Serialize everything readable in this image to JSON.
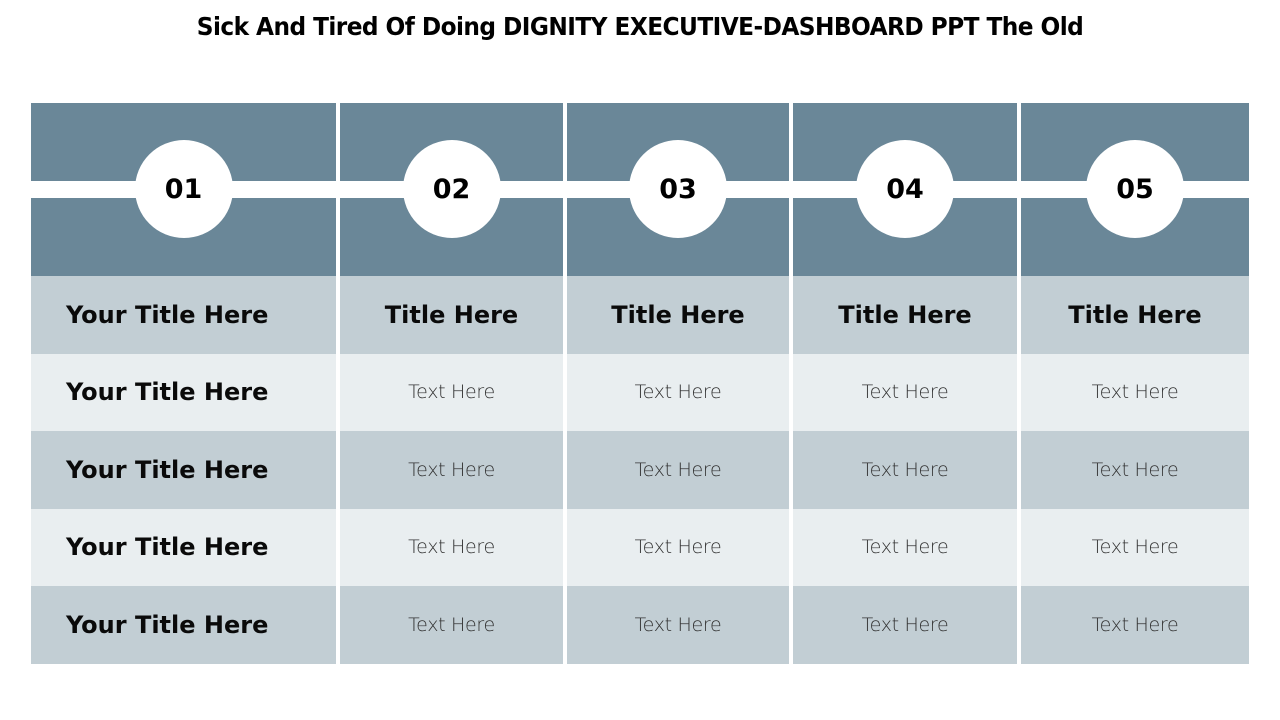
{
  "slide": {
    "title": "Sick And Tired Of Doing DIGNITY EXECUTIVE-DASHBOARD PPT The Old"
  },
  "colors": {
    "header": "#6a8798",
    "row_dark": "#c2ced4",
    "row_light": "#e9eef0",
    "circle": "#ffffff"
  },
  "columns": [
    {
      "number": "01",
      "title": "Your Title Here",
      "cells": [
        "Your Title Here",
        "Your Title Here",
        "Your Title Here",
        "Your Title Here"
      ]
    },
    {
      "number": "02",
      "title": "Title Here",
      "cells": [
        "Text Here",
        "Text Here",
        "Text Here",
        "Text Here"
      ]
    },
    {
      "number": "03",
      "title": "Title Here",
      "cells": [
        "Text Here",
        "Text Here",
        "Text Here",
        "Text Here"
      ]
    },
    {
      "number": "04",
      "title": "Title Here",
      "cells": [
        "Text Here",
        "Text Here",
        "Text Here",
        "Text Here"
      ]
    },
    {
      "number": "05",
      "title": "Title Here",
      "cells": [
        "Text Here",
        "Text Here",
        "Text Here",
        "Text Here"
      ]
    }
  ]
}
